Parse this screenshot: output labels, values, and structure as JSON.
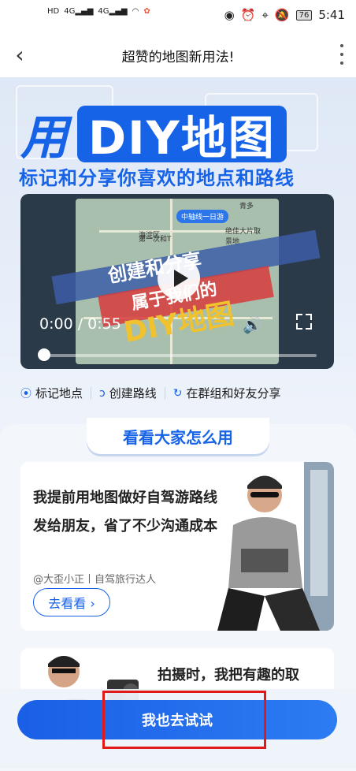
{
  "status_bar": {
    "left_icons": [
      "HD",
      "4G",
      "4G",
      "wifi",
      "app-icon"
    ],
    "battery": "76",
    "time": "5:41"
  },
  "header": {
    "title": "超赞的地图新用法!"
  },
  "hero": {
    "prefix": "用",
    "highlight": "DIY地图",
    "subtitle": "标记和分享你喜欢的地点和路线",
    "accent": "#1763e8"
  },
  "video": {
    "time": "0:00 / 0:55",
    "poster_line1": "创建和分享",
    "poster_line2": "属于我们的",
    "poster_line3": "DIY地图",
    "map_pill": "中轴线一日游",
    "map_labels": [
      "海淀区",
      "第一次和T",
      "绝佳大片取景地",
      "青多"
    ],
    "progress": 0
  },
  "features": [
    {
      "icon": "pin-icon",
      "label": "标记地点"
    },
    {
      "icon": "route-icon",
      "label": "创建路线"
    },
    {
      "icon": "share-icon",
      "label": "在群组和好友分享"
    }
  ],
  "section": {
    "title": "看看大家怎么用"
  },
  "cards": [
    {
      "quote": "我提前用地图做好自驾游路线发给朋友，省了不少沟通成本",
      "author": "@大歪小正丨自驾旅行达人",
      "button": "去看看 ›"
    },
    {
      "quote": "拍摄时，我把有趣的取"
    }
  ],
  "cta": {
    "label": "我也去试试"
  }
}
